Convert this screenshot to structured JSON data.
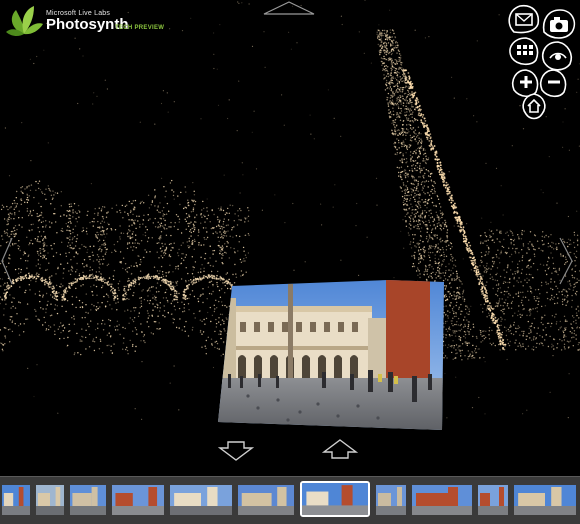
{
  "app": {
    "brand_line": "Microsoft Live Labs",
    "brand_name": "Photosynth",
    "brand_tag": "TECH PREVIEW"
  },
  "controls": {
    "icons": [
      "envelope-icon",
      "camera-icon",
      "grid-icon",
      "eye-icon",
      "zoom-in-icon",
      "zoom-out-icon",
      "home-icon"
    ]
  },
  "navigation": {
    "icons": [
      "nav-up-icon",
      "nav-left-icon",
      "nav-right-icon",
      "nav-back-icon",
      "nav-forward-icon"
    ]
  },
  "filmstrip": {
    "thumbnail_count": 14,
    "selected_index": 6
  },
  "colors": {
    "accent": "#8cc63f",
    "background": "#000000",
    "filmstrip": "#3a3a3a",
    "points": "#f2d9b0"
  }
}
